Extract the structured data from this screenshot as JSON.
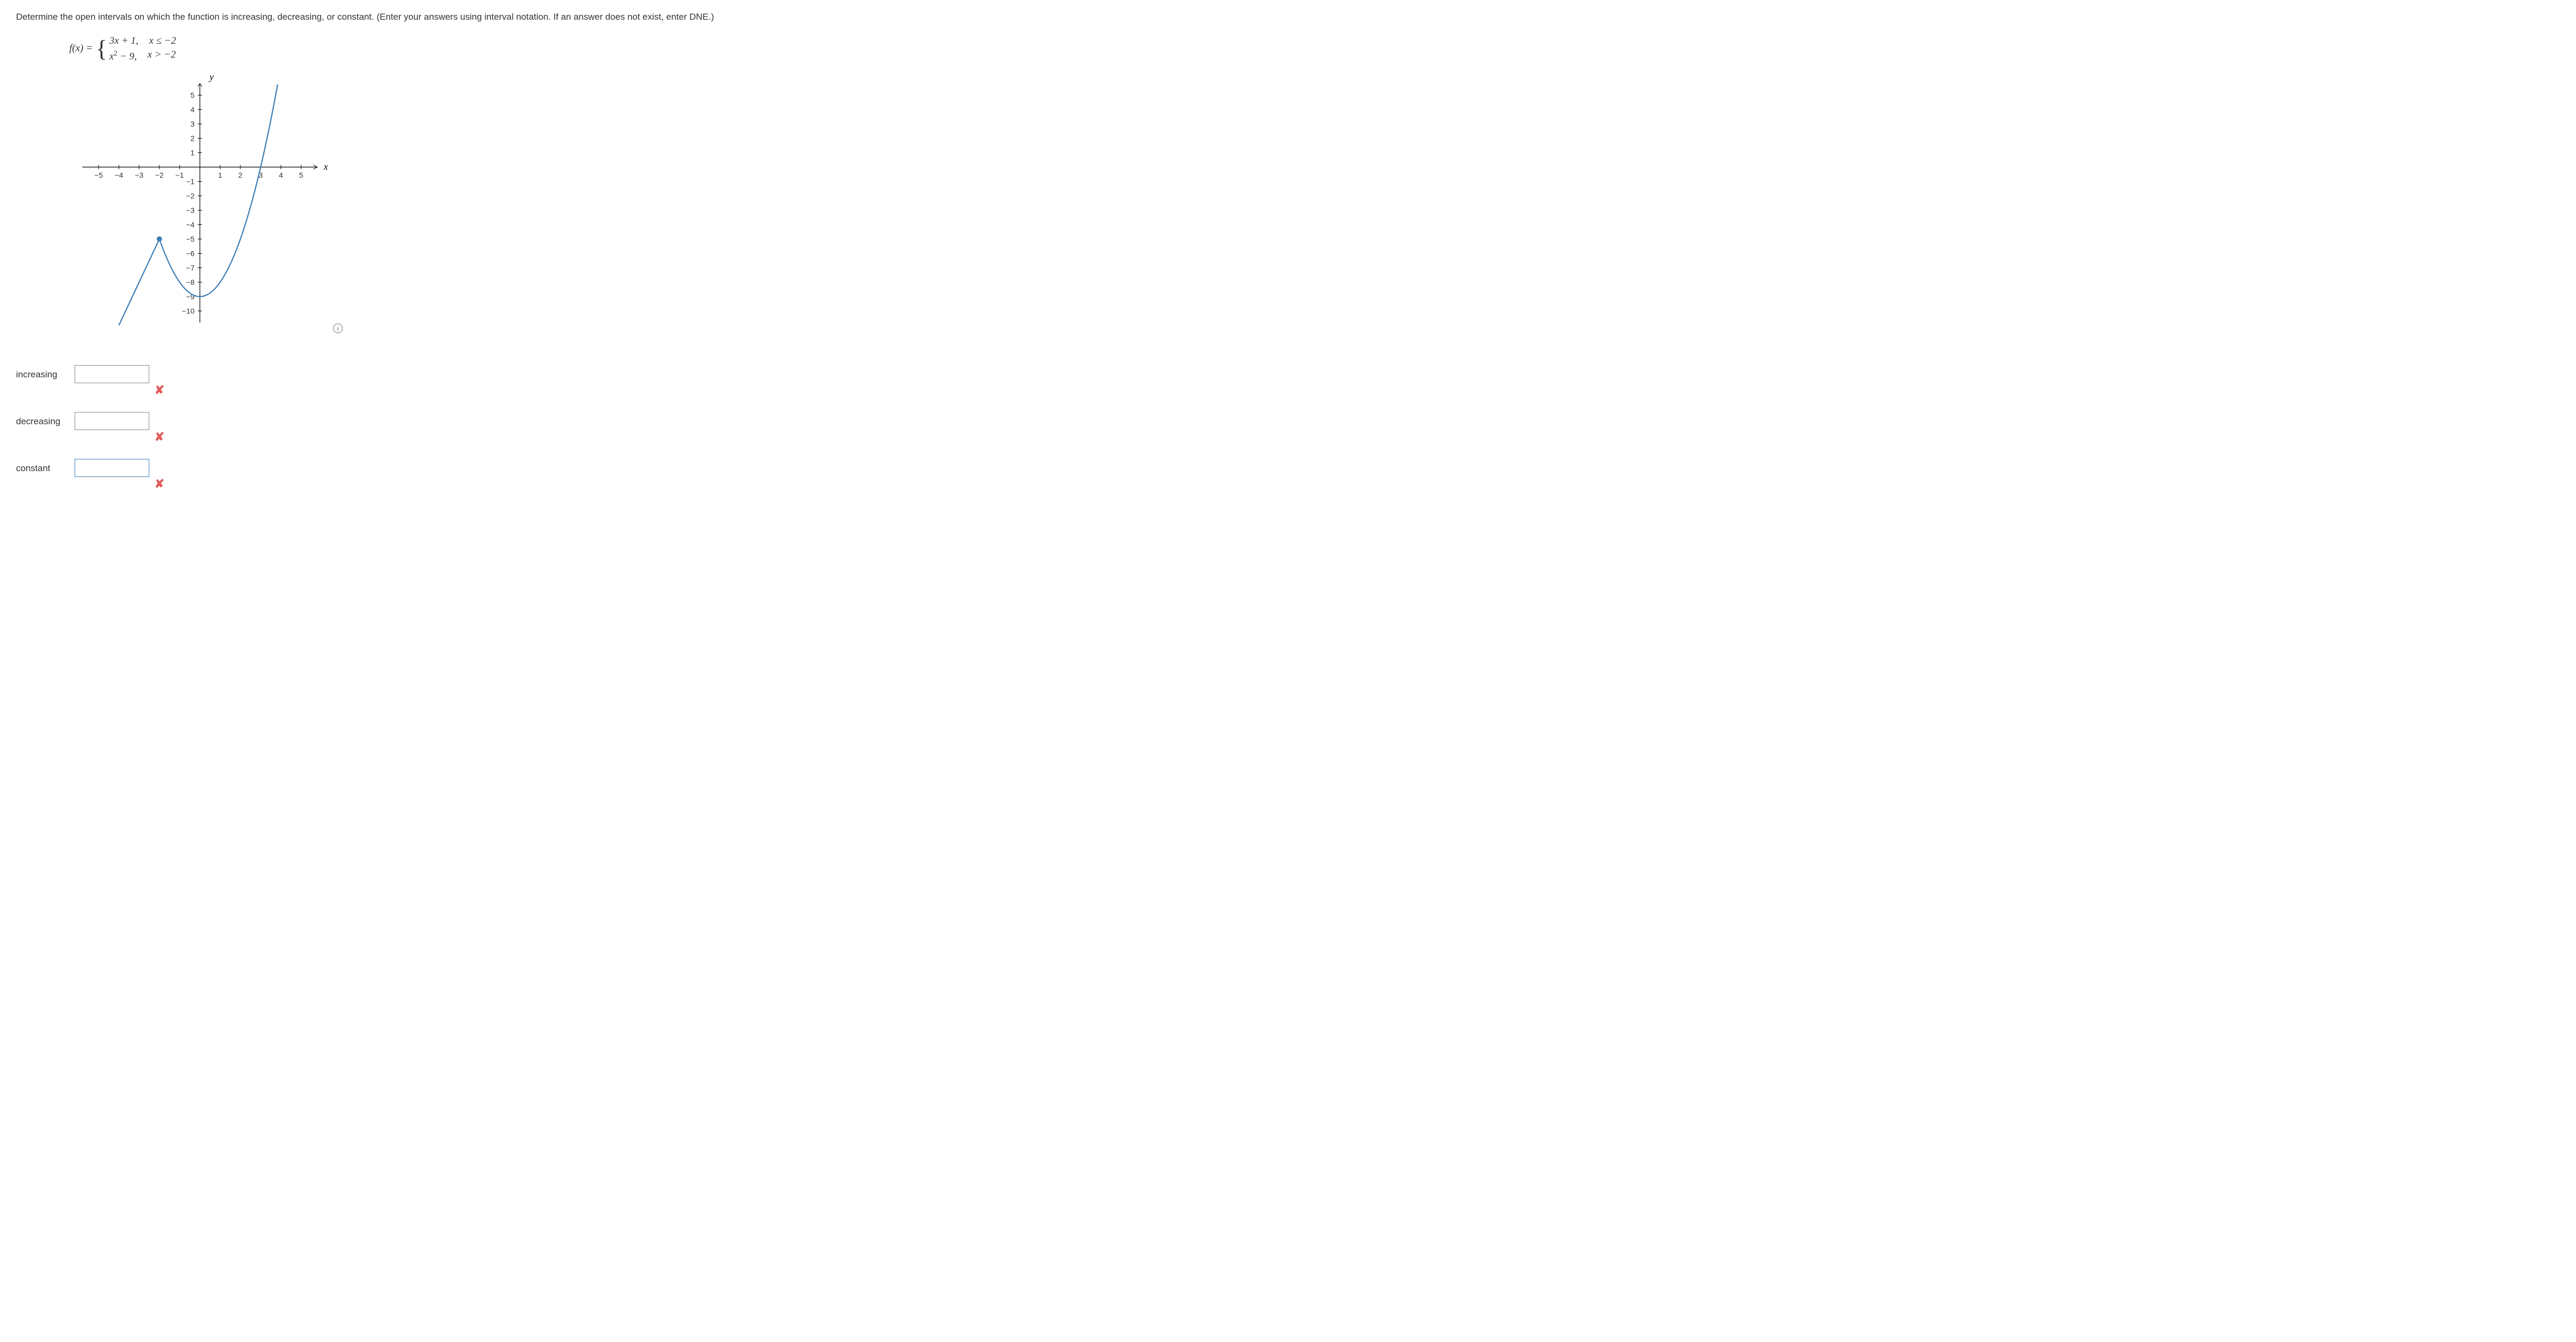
{
  "question": "Determine the open intervals on which the function is increasing, decreasing, or constant. (Enter your answers using interval notation. If an answer does not exist, enter DNE.)",
  "formula": {
    "prefix": "f(x) =",
    "piece1_expr": "3x + 1,",
    "piece1_cond": "x ≤ −2",
    "piece2_expr": "x² − 9,",
    "piece2_cond": "x > −2"
  },
  "chart_data": {
    "type": "line",
    "title": "",
    "xlabel": "x",
    "ylabel": "y",
    "xlim": [
      -6,
      6
    ],
    "ylim": [
      -11,
      6
    ],
    "x_ticks": [
      -5,
      -4,
      -3,
      -2,
      -1,
      1,
      2,
      3,
      4,
      5
    ],
    "y_ticks": [
      -10,
      -9,
      -8,
      -7,
      -6,
      -5,
      -4,
      -3,
      -2,
      -1,
      1,
      2,
      3,
      4,
      5
    ],
    "series": [
      {
        "name": "3x+1 (x ≤ -2)",
        "x": [
          -4,
          -3.5,
          -3,
          -2.5,
          -2
        ],
        "values": [
          -11,
          -9.5,
          -8,
          -6.5,
          -5
        ],
        "endpoint": {
          "x": -2,
          "y": -5,
          "closed": true
        }
      },
      {
        "name": "x²-9 (x > -2)",
        "x": [
          -2,
          -1.5,
          -1,
          -0.5,
          0,
          0.5,
          1,
          1.5,
          2,
          2.5,
          3,
          3.5,
          4
        ],
        "values": [
          -5,
          -6.75,
          -8,
          -8.75,
          -9,
          -8.75,
          -8,
          -6.75,
          -5,
          -2.75,
          0,
          3.25,
          7
        ]
      }
    ]
  },
  "answers": {
    "increasing_label": "increasing",
    "increasing_value": "",
    "decreasing_label": "decreasing",
    "decreasing_value": "",
    "constant_label": "constant",
    "constant_value": ""
  },
  "marks": {
    "wrong": "✘"
  },
  "info_symbol": "i"
}
